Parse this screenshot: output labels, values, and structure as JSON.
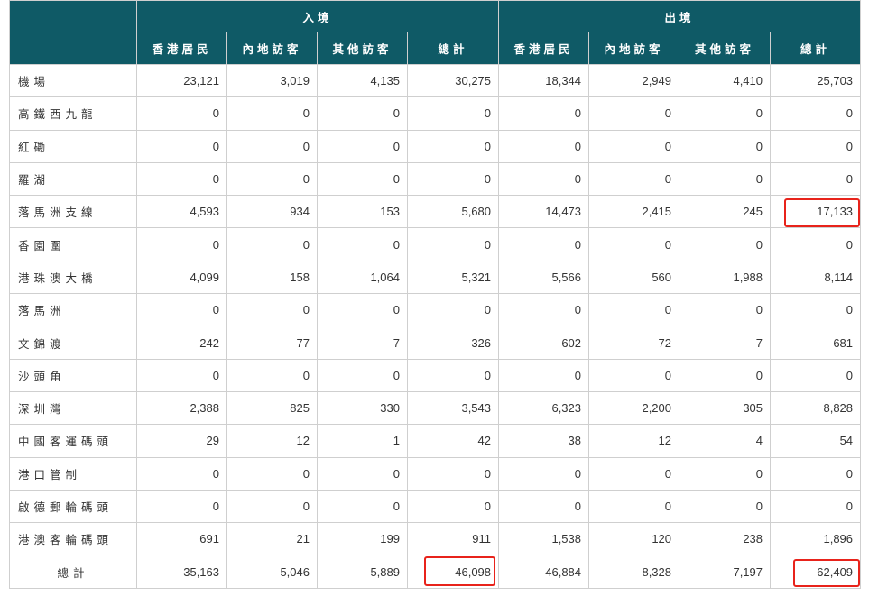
{
  "header": {
    "arrival_label": "入境",
    "departure_label": "出境",
    "columns": [
      "香港居民",
      "內地訪客",
      "其他訪客",
      "總計",
      "香港居民",
      "內地訪客",
      "其他訪客",
      "總計"
    ]
  },
  "rows": [
    {
      "name": "機場",
      "values": [
        "23,121",
        "3,019",
        "4,135",
        "30,275",
        "18,344",
        "2,949",
        "4,410",
        "25,703"
      ]
    },
    {
      "name": "高鐵西九龍",
      "values": [
        "0",
        "0",
        "0",
        "0",
        "0",
        "0",
        "0",
        "0"
      ]
    },
    {
      "name": "紅磡",
      "values": [
        "0",
        "0",
        "0",
        "0",
        "0",
        "0",
        "0",
        "0"
      ]
    },
    {
      "name": "羅湖",
      "values": [
        "0",
        "0",
        "0",
        "0",
        "0",
        "0",
        "0",
        "0"
      ]
    },
    {
      "name": "落馬洲支線",
      "values": [
        "4,593",
        "934",
        "153",
        "5,680",
        "14,473",
        "2,415",
        "245",
        "17,133"
      ]
    },
    {
      "name": "香園圍",
      "values": [
        "0",
        "0",
        "0",
        "0",
        "0",
        "0",
        "0",
        "0"
      ]
    },
    {
      "name": "港珠澳大橋",
      "values": [
        "4,099",
        "158",
        "1,064",
        "5,321",
        "5,566",
        "560",
        "1,988",
        "8,114"
      ]
    },
    {
      "name": "落馬洲",
      "values": [
        "0",
        "0",
        "0",
        "0",
        "0",
        "0",
        "0",
        "0"
      ]
    },
    {
      "name": "文錦渡",
      "values": [
        "242",
        "77",
        "7",
        "326",
        "602",
        "72",
        "7",
        "681"
      ]
    },
    {
      "name": "沙頭角",
      "values": [
        "0",
        "0",
        "0",
        "0",
        "0",
        "0",
        "0",
        "0"
      ]
    },
    {
      "name": "深圳灣",
      "values": [
        "2,388",
        "825",
        "330",
        "3,543",
        "6,323",
        "2,200",
        "305",
        "8,828"
      ]
    },
    {
      "name": "中國客運碼頭",
      "values": [
        "29",
        "12",
        "1",
        "42",
        "38",
        "12",
        "4",
        "54"
      ]
    },
    {
      "name": "港口管制",
      "values": [
        "0",
        "0",
        "0",
        "0",
        "0",
        "0",
        "0",
        "0"
      ]
    },
    {
      "name": "啟德郵輪碼頭",
      "values": [
        "0",
        "0",
        "0",
        "0",
        "0",
        "0",
        "0",
        "0"
      ]
    },
    {
      "name": "港澳客輪碼頭",
      "values": [
        "691",
        "21",
        "199",
        "911",
        "1,538",
        "120",
        "238",
        "1,896"
      ]
    }
  ],
  "total": {
    "name": "總計",
    "values": [
      "35,163",
      "5,046",
      "5,889",
      "46,098",
      "46,884",
      "8,328",
      "7,197",
      "62,409"
    ]
  },
  "highlight_color": "#e8231b",
  "header_color": "#0f5a66"
}
